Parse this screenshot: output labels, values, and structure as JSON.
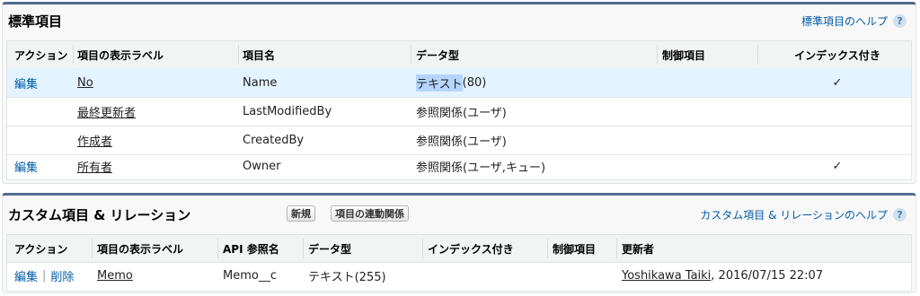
{
  "standard": {
    "title": "標準項目",
    "help": "標準項目のヘルプ",
    "headers": [
      "アクション",
      "項目の表示ラベル",
      "項目名",
      "データ型",
      "制御項目",
      "インデックス付き"
    ],
    "rows": [
      {
        "action": "編集",
        "label": "No",
        "name": "Name",
        "type_sel": "テキスト",
        "type_rest": "(80)",
        "indexed": "✓"
      },
      {
        "action": "",
        "label": "最終更新者",
        "name": "LastModifiedBy",
        "type_sel": "",
        "type_rest": "参照関係(ユーザ)",
        "indexed": ""
      },
      {
        "action": "",
        "label": "作成者",
        "name": "CreatedBy",
        "type_sel": "",
        "type_rest": "参照関係(ユーザ)",
        "indexed": ""
      },
      {
        "action": "編集",
        "label": "所有者",
        "name": "Owner",
        "type_sel": "",
        "type_rest": "参照関係(ユーザ,キュー)",
        "indexed": "✓"
      }
    ]
  },
  "custom": {
    "title": "カスタム項目 & リレーション",
    "new_button": "新規",
    "dependency_button": "項目の連動関係",
    "help": "カスタム項目 & リレーションのヘルプ",
    "headers": [
      "アクション",
      "項目の表示ラベル",
      "API 参照名",
      "データ型",
      "インデックス付き",
      "制御項目",
      "更新者"
    ],
    "rows": [
      {
        "edit": "編集",
        "separator": "|",
        "delete": "削除",
        "label": "Memo",
        "api": "Memo__c",
        "type": "テキスト(255)",
        "indexed": "",
        "control": "",
        "updated_by": "Yoshikawa Taiki",
        "updated_at": ", 2016/07/15 22:07"
      }
    ]
  },
  "help_icon": "?",
  "colors": {
    "link": "#015ba7",
    "header_border": "#54698d",
    "highlight_row": "#e3f3ff"
  }
}
